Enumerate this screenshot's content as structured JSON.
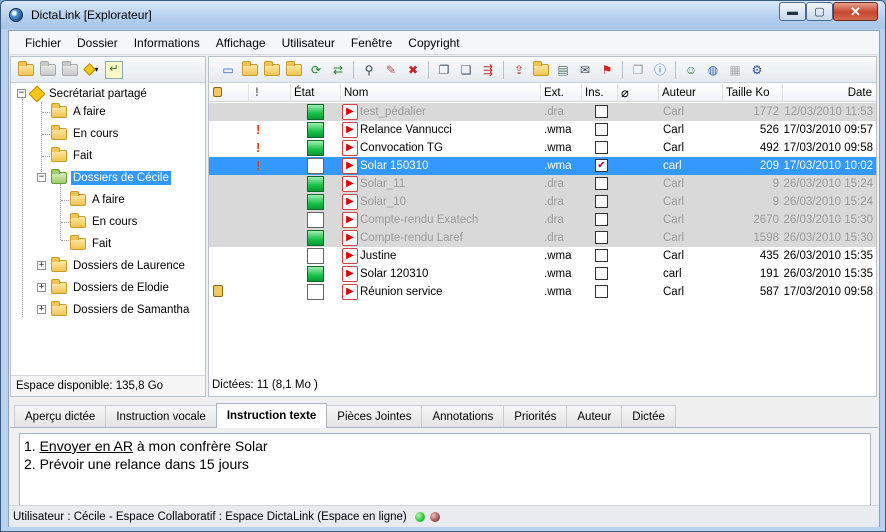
{
  "window": {
    "title": "DictaLink [Explorateur]",
    "close_glyph": "✕",
    "min_glyph": "▬",
    "max_glyph": "▢"
  },
  "menu": [
    "Fichier",
    "Dossier",
    "Informations",
    "Affichage",
    "Utilisateur",
    "Fenêtre",
    "Copyright"
  ],
  "tree": {
    "root": "Secrétariat partagé",
    "items": [
      "A faire",
      "En cours",
      "Fait",
      "Dossiers de Cécile",
      "A faire",
      "En cours",
      "Fait",
      "Dossiers de Laurence",
      "Dossiers de Elodie",
      "Dossiers de Samantha"
    ],
    "selected": "Dossiers de Cécile"
  },
  "left_status": "Espace disponible: 135,8 Go",
  "grid": {
    "headers": {
      "lock": "",
      "prio": "",
      "state": "État",
      "name": "Nom",
      "ext": "Ext.",
      "ins": "Ins.",
      "attach": "",
      "author": "Auteur",
      "size": "Taille Ko",
      "date": "Date"
    },
    "rows": [
      {
        "name": "test_pédalier",
        "ext": ".dra",
        "ins": false,
        "author": "Carl",
        "size": "1772",
        "date": "12/03/2010 11:53",
        "state": "green",
        "prio": false,
        "lock": false,
        "style": "dim"
      },
      {
        "name": "Relance Vannucci",
        "ext": ".wma",
        "ins": false,
        "author": "Carl",
        "size": "526",
        "date": "17/03/2010 09:57",
        "state": "green",
        "prio": true,
        "lock": false,
        "style": "normal"
      },
      {
        "name": "Convocation TG",
        "ext": ".wma",
        "ins": false,
        "author": "Carl",
        "size": "492",
        "date": "17/03/2010 09:58",
        "state": "green",
        "prio": true,
        "lock": false,
        "style": "normal"
      },
      {
        "name": "Solar 150310",
        "ext": ".wma",
        "ins": true,
        "author": "carl",
        "size": "209",
        "date": "17/03/2010 10:02",
        "state": "white",
        "prio": true,
        "lock": false,
        "style": "sel"
      },
      {
        "name": "Solar_11",
        "ext": ".dra",
        "ins": false,
        "author": "Carl",
        "size": "9",
        "date": "26/03/2010 15:24",
        "state": "green",
        "prio": false,
        "lock": false,
        "style": "dim"
      },
      {
        "name": "Solar_10",
        "ext": ".dra",
        "ins": false,
        "author": "Carl",
        "size": "9",
        "date": "26/03/2010 15:24",
        "state": "green",
        "prio": false,
        "lock": false,
        "style": "dim"
      },
      {
        "name": "Compte-rendu Exatech",
        "ext": ".dra",
        "ins": false,
        "author": "Carl",
        "size": "2670",
        "date": "26/03/2010 15:30",
        "state": "white",
        "prio": false,
        "lock": false,
        "style": "dim"
      },
      {
        "name": "Compte-rendu Laref",
        "ext": ".dra",
        "ins": false,
        "author": "Carl",
        "size": "1598",
        "date": "26/03/2010 15:30",
        "state": "green",
        "prio": false,
        "lock": false,
        "style": "dim"
      },
      {
        "name": "Justine",
        "ext": ".wma",
        "ins": false,
        "author": "Carl",
        "size": "435",
        "date": "26/03/2010 15:35",
        "state": "white",
        "prio": false,
        "lock": false,
        "style": "normal"
      },
      {
        "name": "Solar 120310",
        "ext": ".wma",
        "ins": false,
        "author": "carl",
        "size": "191",
        "date": "26/03/2010 15:35",
        "state": "green",
        "prio": false,
        "lock": false,
        "style": "normal"
      },
      {
        "name": "Réunion service",
        "ext": ".wma",
        "ins": false,
        "author": "Carl",
        "size": "587",
        "date": "17/03/2010 09:58",
        "state": "white",
        "prio": false,
        "lock": true,
        "style": "normal"
      }
    ]
  },
  "dictees_count": "Dictées: 11 (8,1 Mo )",
  "tabs": [
    "Aperçu dictée",
    "Instruction vocale",
    "Instruction texte",
    "Pièces Jointes",
    "Annotations",
    "Priorités",
    "Auteur",
    "Dictée"
  ],
  "active_tab": "Instruction texte",
  "note": {
    "line1_prefix": "1. ",
    "line1_link": "Envoyer en AR",
    "line1_rest": " à mon confrère Solar",
    "line2": "2. Prévoir une relance dans 15 jours"
  },
  "status_text": "Utilisateur : Cécile - Espace Collaboratif : Espace DictaLink (Espace en ligne)",
  "colors": {
    "selection": "#3399ff",
    "status_green": "#2cc23a",
    "status_gray": "#a05050"
  }
}
